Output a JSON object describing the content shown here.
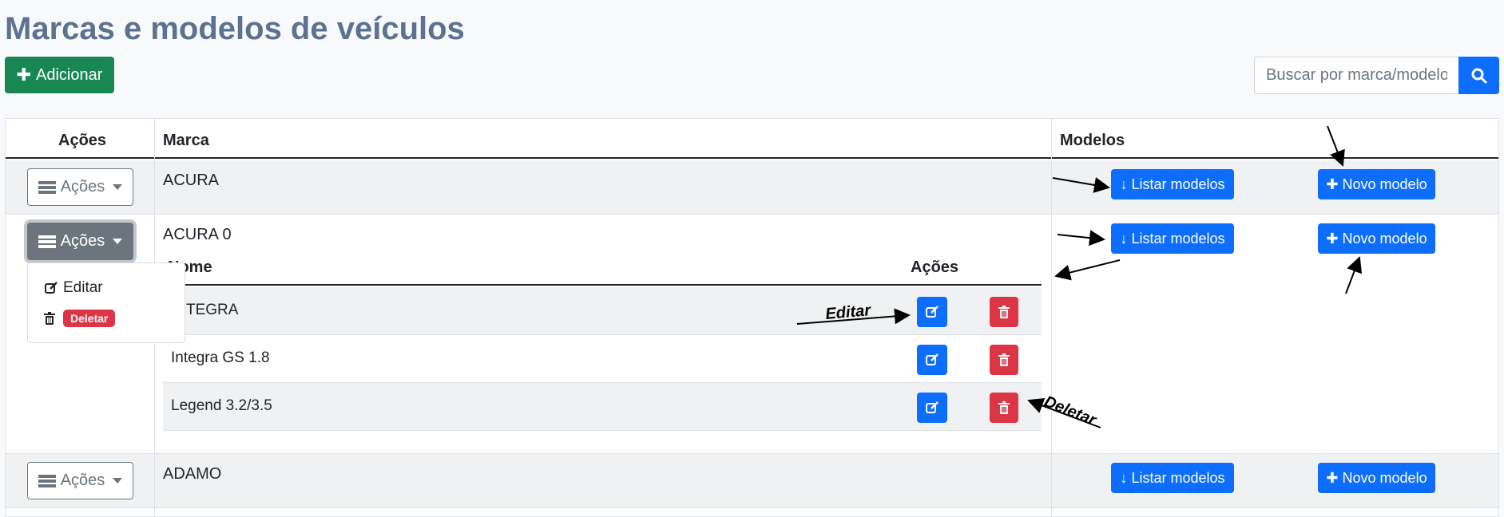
{
  "page": {
    "title": "Marcas e modelos de veículos",
    "add_label": "Adicionar"
  },
  "search": {
    "placeholder": "Buscar por marca/modelo"
  },
  "table": {
    "headers": {
      "actions": "Ações",
      "brand": "Marca",
      "models": "Modelos"
    },
    "actions_label": "Ações",
    "list_models_label": "Listar modelos",
    "new_model_label": "Novo modelo",
    "rows": [
      {
        "brand": "ACURA"
      },
      {
        "brand": "ACURA 0"
      },
      {
        "brand": "ADAMO"
      }
    ]
  },
  "dropdown": {
    "edit_label": "Editar",
    "delete_label": "Deletar"
  },
  "subtable": {
    "headers": {
      "name": "Nome",
      "actions": "Ações"
    },
    "rows": [
      {
        "name": "INTEGRA"
      },
      {
        "name": "Integra GS 1.8"
      },
      {
        "name": "Legend 3.2/3.5"
      }
    ]
  },
  "annotations": {
    "edit": "Editar",
    "delete": "Deletar"
  },
  "colors": {
    "primary": "#0d6efd",
    "success": "#198754",
    "danger": "#dc3545",
    "secondary": "#6c757d",
    "title": "#5b7390"
  }
}
